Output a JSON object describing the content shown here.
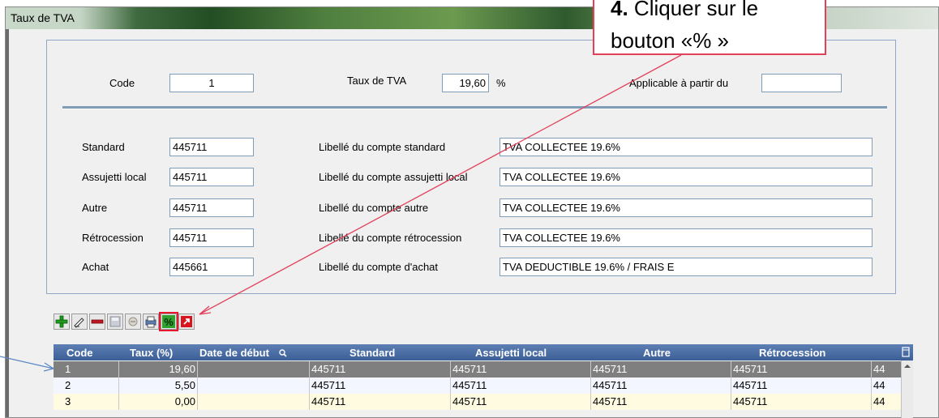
{
  "window": {
    "title": "Taux de TVA"
  },
  "header_fields": {
    "code_label": "Code",
    "code_value": "1",
    "taux_label": "Taux de TVA",
    "taux_value": "19,60",
    "taux_unit": "%",
    "date_label": "Applicable à partir du",
    "date_value": ""
  },
  "accounts": [
    {
      "label": "Standard",
      "value": "445711",
      "desc_label": "Libellé du compte standard",
      "desc_value": "TVA COLLECTEE 19.6%"
    },
    {
      "label": "Assujetti local",
      "value": "445711",
      "desc_label": "Libellé du compte assujetti local",
      "desc_value": "TVA COLLECTEE 19.6%"
    },
    {
      "label": "Autre",
      "value": "445711",
      "desc_label": "Libellé du compte autre",
      "desc_value": "TVA COLLECTEE 19.6%"
    },
    {
      "label": "Rétrocession",
      "value": "445711",
      "desc_label": "Libellé du compte rétrocession",
      "desc_value": "TVA COLLECTEE 19.6%"
    },
    {
      "label": "Achat",
      "value": "445661",
      "desc_label": "Libellé du compte d'achat",
      "desc_value": "TVA DEDUCTIBLE 19.6% / FRAIS E"
    }
  ],
  "toolbar": {
    "buttons": [
      "add-icon",
      "edit-icon",
      "delete-icon",
      "save-icon",
      "cancel-icon",
      "print-icon",
      "percent-icon",
      "exit-icon"
    ]
  },
  "grid": {
    "columns": [
      "Code",
      "Taux (%)",
      "Date de début",
      "Standard",
      "Assujetti local",
      "Autre",
      "Rétrocession"
    ],
    "rows": [
      [
        "1",
        "19,60",
        "",
        "445711",
        "445711",
        "445711",
        "445711",
        "44"
      ],
      [
        "2",
        "5,50",
        "",
        "445711",
        "445711",
        "445711",
        "445711",
        "44"
      ],
      [
        "3",
        "0,00",
        "",
        "445711",
        "445711",
        "445711",
        "445711",
        "44"
      ]
    ]
  },
  "callout": {
    "step": "4.",
    "text_line1": "Cliquer sur le",
    "text_line2": "bouton «% »"
  },
  "colors": {
    "accent": "#e3405a",
    "grid_header": "#4a6ea6",
    "row_selected": "#7f7f7f"
  }
}
